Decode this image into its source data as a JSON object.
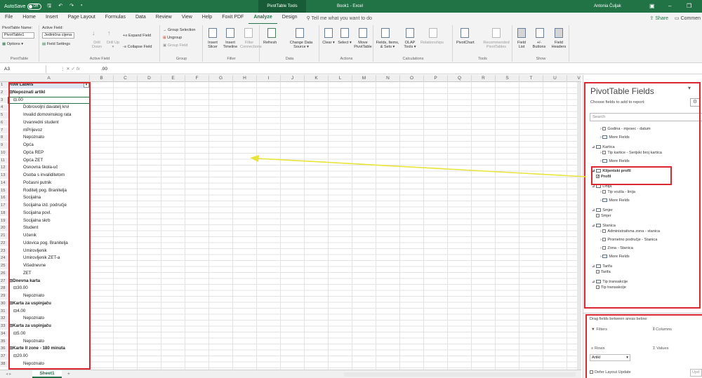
{
  "title_bar": {
    "autosave_label": "AutoSave",
    "autosave_state": "Off",
    "quick_access": "🖫 ↶ ↷ ▾",
    "context_tab": "PivotTable Tools",
    "workbook": "Book1 - Excel",
    "user": "Antonia Čuljak",
    "ribbon_display": "▣",
    "minimize": "–",
    "restore": "❐"
  },
  "menu": {
    "tabs": [
      "File",
      "Home",
      "Insert",
      "Page Layout",
      "Formulas",
      "Data",
      "Review",
      "View",
      "Help",
      "Foxit PDF",
      "Analyze",
      "Design"
    ],
    "active_tab": "Analyze",
    "tell_me": "Tell me what you want to do",
    "share": "Share",
    "comments": "Commen"
  },
  "ribbon": {
    "pivottable": {
      "name_label": "PivotTable Name:",
      "name_value": "PivotTable1",
      "options": "Options ▾",
      "group": "PivotTable"
    },
    "active_field": {
      "label": "Active Field:",
      "value": "Jedinična cijena",
      "settings": "Field Settings",
      "drill_down": "Drill Down",
      "drill_up": "Drill Up ▾",
      "expand": "Expand Field",
      "collapse": "Collapse Field",
      "group": "Active Field"
    },
    "group": {
      "selection": "Group Selection",
      "ungroup": "Ungroup",
      "field": "Group Field",
      "group": "Group"
    },
    "filter": {
      "slicer": "Insert Slicer",
      "timeline": "Insert Timeline",
      "connections": "Filter Connections",
      "group": "Filter"
    },
    "data": {
      "refresh": "Refresh",
      "change_source": "Change Data Source ▾",
      "group": "Data"
    },
    "actions": {
      "clear": "Clear ▾",
      "select": "Select ▾",
      "move": "Move PivotTable",
      "group": "Actions"
    },
    "calculations": {
      "fields": "Fields, Items, & Sets ▾",
      "olap": "OLAP Tools ▾",
      "relationships": "Relationships",
      "group": "Calculations"
    },
    "tools": {
      "pivotchart": "PivotChart",
      "recommended": "Recommended PivotTables",
      "group": "Tools"
    },
    "show": {
      "field_list": "Field List",
      "buttons": "+/- Buttons",
      "headers": "Field Headers",
      "group": "Show"
    }
  },
  "formula_bar": {
    "name_box": "A3",
    "fx": "fx",
    "value": ".00"
  },
  "columns": [
    "A",
    "B",
    "C",
    "D",
    "E",
    "F",
    "G",
    "H",
    "I",
    "J",
    "K",
    "L",
    "M",
    "N",
    "O",
    "P",
    "Q",
    "R",
    "S",
    "T",
    "U",
    "V"
  ],
  "rows": [
    {
      "n": "1",
      "text": "Row Labels",
      "level": 0,
      "bold": true
    },
    {
      "n": "2",
      "text": "⊟Nepoznati artikl",
      "level": 0,
      "bold": true
    },
    {
      "n": "3",
      "text": "⊟.00",
      "level": 1,
      "bold": false
    },
    {
      "n": "4",
      "text": "Dobrovoljni davatelj krvi",
      "level": 2,
      "bold": false
    },
    {
      "n": "5",
      "text": "Invalid domovinskog rata",
      "level": 2,
      "bold": false
    },
    {
      "n": "6",
      "text": "Izvanredni student",
      "level": 2,
      "bold": false
    },
    {
      "n": "7",
      "text": "mPrijevoz",
      "level": 2,
      "bold": false
    },
    {
      "n": "8",
      "text": "Nepoznato",
      "level": 2,
      "bold": false
    },
    {
      "n": "9",
      "text": "Opća",
      "level": 2,
      "bold": false
    },
    {
      "n": "10",
      "text": "Opća REP",
      "level": 2,
      "bold": false
    },
    {
      "n": "11",
      "text": "Opća ZET",
      "level": 2,
      "bold": false
    },
    {
      "n": "12",
      "text": "Osnovna škola-uč",
      "level": 2,
      "bold": false
    },
    {
      "n": "13",
      "text": "Osoba s invaliditetom",
      "level": 2,
      "bold": false
    },
    {
      "n": "14",
      "text": "Počasni putnik",
      "level": 2,
      "bold": false
    },
    {
      "n": "15",
      "text": "Roditelj pog. Branitelja",
      "level": 2,
      "bold": false
    },
    {
      "n": "16",
      "text": "Socijalna",
      "level": 2,
      "bold": false
    },
    {
      "n": "17",
      "text": "Socijalna izd. područje",
      "level": 2,
      "bold": false
    },
    {
      "n": "18",
      "text": "Socijalna povl.",
      "level": 2,
      "bold": false
    },
    {
      "n": "19",
      "text": "Socijalna skrb",
      "level": 2,
      "bold": false
    },
    {
      "n": "20",
      "text": "Student",
      "level": 2,
      "bold": false
    },
    {
      "n": "21",
      "text": "Učenik",
      "level": 2,
      "bold": false
    },
    {
      "n": "22",
      "text": "Udovica pog. Branitelja",
      "level": 2,
      "bold": false
    },
    {
      "n": "23",
      "text": "Umirovljenik",
      "level": 2,
      "bold": false
    },
    {
      "n": "24",
      "text": "Umirovljenik ZET-a",
      "level": 2,
      "bold": false
    },
    {
      "n": "25",
      "text": "Višednevne",
      "level": 2,
      "bold": false
    },
    {
      "n": "26",
      "text": "ZET",
      "level": 2,
      "bold": false
    },
    {
      "n": "27",
      "text": "⊟Dnevna karta",
      "level": 0,
      "bold": true
    },
    {
      "n": "28",
      "text": "⊟30.00",
      "level": 1,
      "bold": false
    },
    {
      "n": "29",
      "text": "Nepoznato",
      "level": 2,
      "bold": false
    },
    {
      "n": "30",
      "text": "⊟Karta za uspinjaču",
      "level": 0,
      "bold": true
    },
    {
      "n": "31",
      "text": "⊟4.00",
      "level": 1,
      "bold": false
    },
    {
      "n": "32",
      "text": "Nepoznato",
      "level": 2,
      "bold": false
    },
    {
      "n": "33",
      "text": "⊟Karta za uspinjaču",
      "level": 0,
      "bold": true
    },
    {
      "n": "34",
      "text": "⊟5.00",
      "level": 1,
      "bold": false
    },
    {
      "n": "35",
      "text": "Nepoznato",
      "level": 2,
      "bold": false
    },
    {
      "n": "36",
      "text": "⊟Karte II zone - 180 minuta",
      "level": 0,
      "bold": true
    },
    {
      "n": "37",
      "text": "⊟20.00",
      "level": 1,
      "bold": false
    },
    {
      "n": "38",
      "text": "Nepoznato",
      "level": 2,
      "bold": false
    }
  ],
  "sheet": {
    "tab": "Sheet1",
    "add": "+",
    "nav": "◂ ▸"
  },
  "panel": {
    "title": "PivotTable Fields",
    "choose": "Choose fields to add to report:",
    "search_placeholder": "Search",
    "fields": [
      {
        "text": "Godina - mjesec - datum",
        "type": "cb",
        "indent": 2
      },
      {
        "text": "More Fields",
        "type": "tbl",
        "indent": 2
      },
      {
        "text": "Kartica",
        "type": "tbl",
        "indent": 0
      },
      {
        "text": "Tip kartice - Serijski broj kartica",
        "type": "cb",
        "indent": 2
      },
      {
        "text": "More Fields",
        "type": "tbl",
        "indent": 2
      },
      {
        "text": "Klijentski profil",
        "type": "tbl",
        "indent": 0,
        "bold": true
      },
      {
        "text": "Profil",
        "type": "cb",
        "indent": 1,
        "checked": true,
        "bold": true
      },
      {
        "text": "Linija",
        "type": "tbl",
        "indent": 0
      },
      {
        "text": "Tip vozila - linija",
        "type": "cb",
        "indent": 2
      },
      {
        "text": "More Fields",
        "type": "tbl",
        "indent": 2
      },
      {
        "text": "Smjer",
        "type": "tbl",
        "indent": 0
      },
      {
        "text": "Smjer",
        "type": "cb",
        "indent": 1
      },
      {
        "text": "Stanica",
        "type": "tbl",
        "indent": 0
      },
      {
        "text": "Administrativna zona - stanica",
        "type": "cb",
        "indent": 2
      },
      {
        "text": "Prometno područje - Stanica",
        "type": "cb",
        "indent": 2
      },
      {
        "text": "Zona - Stanica",
        "type": "cb",
        "indent": 2
      },
      {
        "text": "More Fields",
        "type": "tbl",
        "indent": 2
      },
      {
        "text": "Tarifa",
        "type": "tbl",
        "indent": 0
      },
      {
        "text": "Tarifa",
        "type": "cb",
        "indent": 1
      },
      {
        "text": "Tip transakcije",
        "type": "tbl",
        "indent": 0
      },
      {
        "text": "Tip transakcije",
        "type": "cb",
        "indent": 1
      }
    ],
    "drag_text": "Drag fields between areas below:",
    "filters": "Filters",
    "columns": "Columns",
    "rows": "Rows",
    "values": "Values",
    "rows_value": "Artikl",
    "defer": "Defer Layout Update",
    "update": "Upd"
  },
  "colors": {
    "accent": "#217346",
    "highlight": "#d9282f",
    "arrow": "#e8e43a"
  }
}
